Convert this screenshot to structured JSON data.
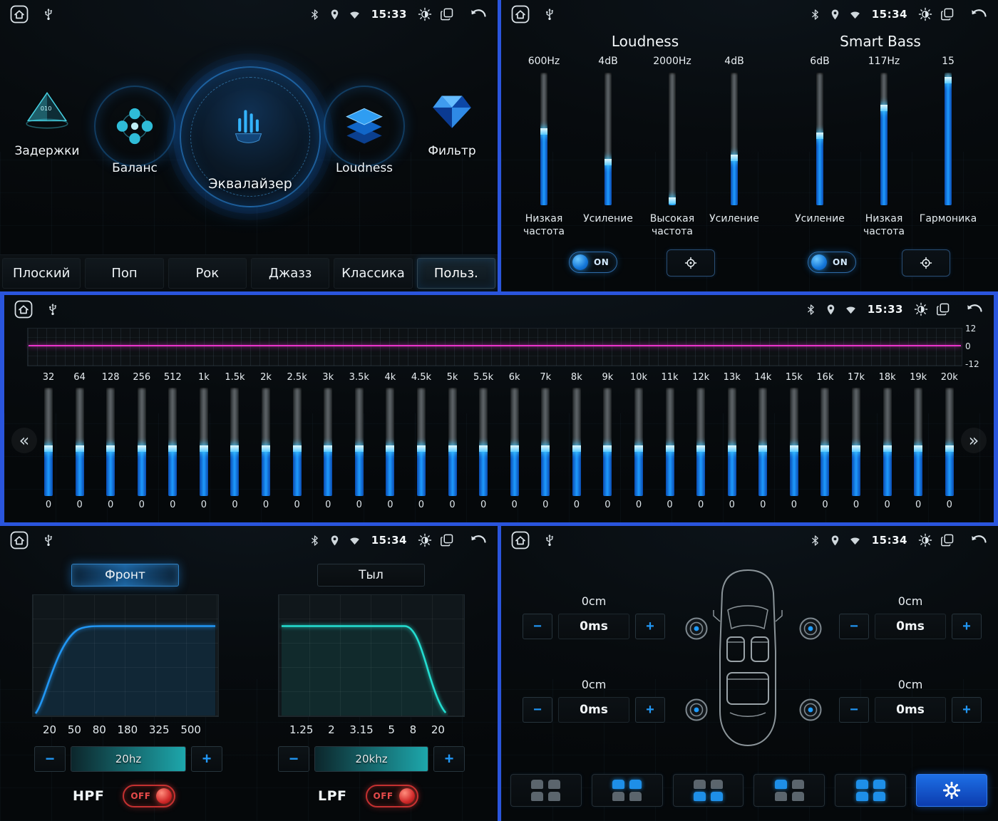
{
  "theme": {
    "frame_blue": "#2a55dd",
    "accent": "#1e9bff",
    "slider_highlight": "#58c9ff",
    "magenta_line": "#ea33cb",
    "teal_curve": "#24ddd0",
    "off_red": "#e03838"
  },
  "controls": {
    "minus": "−",
    "plus": "+"
  },
  "menu_panel": {
    "time": "15:33",
    "items": [
      {
        "label": "Задержки"
      },
      {
        "label": "Баланс"
      },
      {
        "label": "Эквалайзер"
      },
      {
        "label": "Loudness"
      },
      {
        "label": "Фильтр"
      }
    ],
    "presets": [
      {
        "label": "Плоский",
        "selected": false
      },
      {
        "label": "Поп",
        "selected": false
      },
      {
        "label": "Рок",
        "selected": false
      },
      {
        "label": "Джазз",
        "selected": false
      },
      {
        "label": "Классика",
        "selected": false
      },
      {
        "label": "Польз.",
        "selected": true
      }
    ]
  },
  "loudness_panel": {
    "time": "15:34",
    "sections": [
      {
        "title": "Loudness"
      },
      {
        "title": "Smart Bass"
      }
    ],
    "sliders": [
      {
        "top": "600Hz",
        "bottom": "Низкая частота",
        "pct": 58
      },
      {
        "top": "4dB",
        "bottom": "Усиление",
        "pct": 35
      },
      {
        "top": "2000Hz",
        "bottom": "Высокая частота",
        "pct": 6
      },
      {
        "top": "4dB",
        "bottom": "Усиление",
        "pct": 38
      },
      {
        "top": "6dB",
        "bottom": "Усиление",
        "pct": 55
      },
      {
        "top": "117Hz",
        "bottom": "Низкая частота",
        "pct": 76
      },
      {
        "top": "15",
        "bottom": "Гармоника",
        "pct": 97
      }
    ],
    "toggles": [
      {
        "label": "ON"
      },
      {
        "label": "ON"
      }
    ]
  },
  "eq_panel": {
    "time": "15:33",
    "scale_labels": [
      "12",
      "0",
      "-12"
    ],
    "nav": {
      "prev": "«",
      "next": "»"
    },
    "band_value": "0",
    "band_fill_pct": 47,
    "bands": [
      "32",
      "64",
      "128",
      "256",
      "512",
      "1k",
      "1.5k",
      "2k",
      "2.5k",
      "3k",
      "3.5k",
      "4k",
      "4.5k",
      "5k",
      "5.5k",
      "6k",
      "7k",
      "8k",
      "9k",
      "10k",
      "11k",
      "12k",
      "13k",
      "14k",
      "15k",
      "16k",
      "17k",
      "18k",
      "19k",
      "20k"
    ]
  },
  "filters_panel": {
    "time": "15:34",
    "tabs": [
      {
        "label": "Фронт",
        "selected": true
      },
      {
        "label": "Тыл",
        "selected": false
      }
    ],
    "hpf": {
      "name": "HPF",
      "state": "OFF",
      "value": "20hz",
      "axis": [
        "20",
        "50",
        "80",
        "180",
        "325",
        "500"
      ]
    },
    "lpf": {
      "name": "LPF",
      "state": "OFF",
      "value": "20khz",
      "axis": [
        "1.25",
        "2",
        "3.15",
        "5",
        "8",
        "20"
      ]
    }
  },
  "delays_panel": {
    "time": "15:34",
    "corners": [
      {
        "position": "front-left",
        "cm": "0cm",
        "ms": "0ms"
      },
      {
        "position": "front-right",
        "cm": "0cm",
        "ms": "0ms"
      },
      {
        "position": "rear-left",
        "cm": "0cm",
        "ms": "0ms"
      },
      {
        "position": "rear-right",
        "cm": "0cm",
        "ms": "0ms"
      }
    ],
    "seat_presets": [
      {
        "name": "none",
        "seats": [
          false,
          false,
          false,
          false
        ]
      },
      {
        "name": "front",
        "seats": [
          true,
          true,
          false,
          false
        ]
      },
      {
        "name": "rear",
        "seats": [
          false,
          false,
          true,
          true
        ]
      },
      {
        "name": "driver",
        "seats": [
          true,
          false,
          false,
          false
        ]
      },
      {
        "name": "all",
        "seats": [
          true,
          true,
          true,
          true
        ]
      }
    ]
  }
}
